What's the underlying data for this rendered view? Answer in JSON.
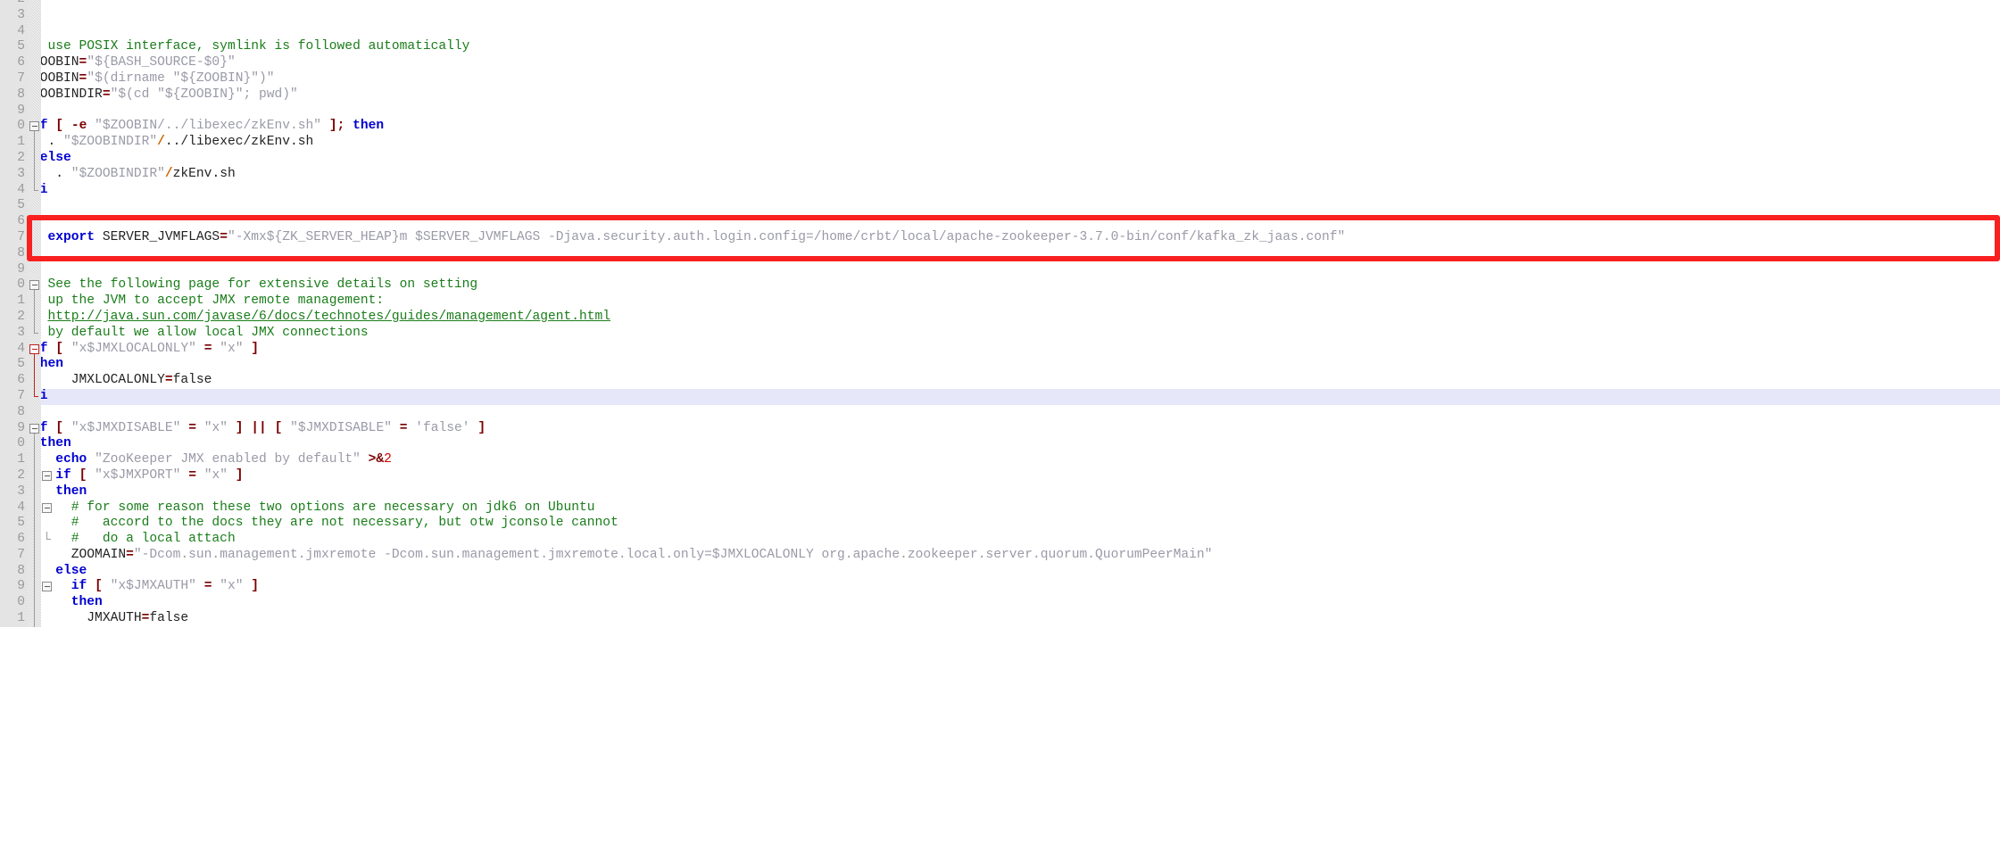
{
  "editor": {
    "kind": "code-editor",
    "language": "shell",
    "colors": {
      "background": "#ffffff",
      "gutter_background": "#e4e4e4",
      "gutter_text": "#9a9a9a",
      "current_line_highlight": "#e7e7fa",
      "keyword": "#0000d0",
      "comment": "#1a7d1a",
      "string": "#9a9aa8",
      "operator": "#7a0000",
      "number": "#d00000",
      "annotation_box": "#f92020"
    },
    "annotation": {
      "name": "red-highlight-box",
      "target_line": "7",
      "description": "export SERVER_JVMFLAGS line"
    },
    "lines": [
      {
        "num": "2",
        "clipped_top": true,
        "fold": "none",
        "tokens": [
          {
            "t": "#",
            "c": "cmt"
          }
        ]
      },
      {
        "num": "3",
        "fold": "none",
        "tokens": []
      },
      {
        "num": "4",
        "fold": "none",
        "tokens": []
      },
      {
        "num": "5",
        "fold": "none",
        "tokens": [
          {
            "t": "# use POSIX interface, symlink is followed automatically",
            "c": "cmt"
          }
        ]
      },
      {
        "num": "6",
        "fold": "none",
        "tokens": [
          {
            "t": "ZOOBIN",
            "c": "plain"
          },
          {
            "t": "=",
            "c": "op"
          },
          {
            "t": "\"${BASH_SOURCE-$0}\"",
            "c": "str"
          }
        ]
      },
      {
        "num": "7",
        "fold": "none",
        "tokens": [
          {
            "t": "ZOOBIN",
            "c": "plain"
          },
          {
            "t": "=",
            "c": "op"
          },
          {
            "t": "\"$(dirname \"${ZOOBIN}\")\"",
            "c": "str"
          }
        ]
      },
      {
        "num": "8",
        "fold": "none",
        "tokens": [
          {
            "t": "ZOOBINDIR",
            "c": "plain"
          },
          {
            "t": "=",
            "c": "op"
          },
          {
            "t": "\"$(cd \"${ZOOBIN}\"; pwd)\"",
            "c": "str"
          }
        ]
      },
      {
        "num": "9",
        "fold": "none",
        "tokens": []
      },
      {
        "num": "0",
        "fold": "start",
        "tokens": [
          {
            "t": "if",
            "c": "kw"
          },
          {
            "t": " ",
            "c": "plain"
          },
          {
            "t": "[",
            "c": "op"
          },
          {
            "t": " ",
            "c": "plain"
          },
          {
            "t": "-e",
            "c": "op"
          },
          {
            "t": " ",
            "c": "plain"
          },
          {
            "t": "\"$ZOOBIN/../libexec/zkEnv.sh\"",
            "c": "str"
          },
          {
            "t": " ",
            "c": "plain"
          },
          {
            "t": "];",
            "c": "op"
          },
          {
            "t": " ",
            "c": "plain"
          },
          {
            "t": "then",
            "c": "kw"
          }
        ]
      },
      {
        "num": "1",
        "fold": "mid",
        "tokens": [
          {
            "t": "  . ",
            "c": "plain"
          },
          {
            "t": "\"$ZOOBINDIR\"",
            "c": "str"
          },
          {
            "t": "/",
            "c": "slash"
          },
          {
            "t": "../libexec/zkEnv.sh",
            "c": "plain"
          }
        ]
      },
      {
        "num": "2",
        "fold": "mid",
        "tokens": [
          {
            "t": " else",
            "c": "kw"
          }
        ]
      },
      {
        "num": "3",
        "fold": "mid",
        "tokens": [
          {
            "t": "   . ",
            "c": "plain"
          },
          {
            "t": "\"$ZOOBINDIR\"",
            "c": "str"
          },
          {
            "t": "/",
            "c": "slash"
          },
          {
            "t": "zkEnv.sh",
            "c": "plain"
          }
        ]
      },
      {
        "num": "4",
        "fold": "end",
        "tokens": [
          {
            "t": "fi",
            "c": "kw"
          }
        ]
      },
      {
        "num": "5",
        "fold": "none",
        "tokens": []
      },
      {
        "num": "6",
        "fold": "none",
        "tokens": []
      },
      {
        "num": "7",
        "fold": "none",
        "boxed": true,
        "tokens": [
          {
            "t": "  ",
            "c": "plain"
          },
          {
            "t": "export",
            "c": "kw"
          },
          {
            "t": " SERVER_JVMFLAGS",
            "c": "plain"
          },
          {
            "t": "=",
            "c": "op"
          },
          {
            "t": "\"-Xmx${ZK_SERVER_HEAP}m $SERVER_JVMFLAGS -Djava.security.auth.login.config=/home/crbt/local/apache-zookeeper-3.7.0-bin/conf/kafka_zk_jaas.conf\"",
            "c": "str"
          }
        ]
      },
      {
        "num": "8",
        "fold": "none",
        "tokens": []
      },
      {
        "num": "9",
        "fold": "none",
        "tokens": []
      },
      {
        "num": "0",
        "fold": "start",
        "tokens": [
          {
            "t": "# See the following page for extensive details on setting",
            "c": "cmt"
          }
        ]
      },
      {
        "num": "1",
        "fold": "mid",
        "tokens": [
          {
            "t": "# up the JVM to accept JMX remote management:",
            "c": "cmt"
          }
        ]
      },
      {
        "num": "2",
        "fold": "mid",
        "tokens": [
          {
            "t": "# ",
            "c": "cmt"
          },
          {
            "t": "http://java.sun.com/javase/6/docs/technotes/guides/management/agent.html",
            "c": "lnk"
          }
        ]
      },
      {
        "num": "3",
        "fold": "end",
        "tokens": [
          {
            "t": "# by default we allow local JMX connections",
            "c": "cmt"
          }
        ]
      },
      {
        "num": "4",
        "fold": "start-red",
        "tokens": [
          {
            "t": "if",
            "c": "kw"
          },
          {
            "t": " ",
            "c": "plain"
          },
          {
            "t": "[",
            "c": "op"
          },
          {
            "t": " ",
            "c": "plain"
          },
          {
            "t": "\"x$JMXLOCALONLY\"",
            "c": "str"
          },
          {
            "t": " ",
            "c": "plain"
          },
          {
            "t": "=",
            "c": "op"
          },
          {
            "t": " ",
            "c": "plain"
          },
          {
            "t": "\"x\"",
            "c": "str"
          },
          {
            "t": " ",
            "c": "plain"
          },
          {
            "t": "]",
            "c": "op"
          }
        ]
      },
      {
        "num": "5",
        "fold": "mid-red",
        "tokens": [
          {
            "t": "then",
            "c": "kw"
          }
        ]
      },
      {
        "num": "6",
        "fold": "mid-red",
        "tokens": [
          {
            "t": "     JMXLOCALONLY",
            "c": "plain"
          },
          {
            "t": "=",
            "c": "op"
          },
          {
            "t": "false",
            "c": "plain"
          }
        ]
      },
      {
        "num": "7",
        "fold": "end-red",
        "current": true,
        "tokens": [
          {
            "t": "fi",
            "c": "kw"
          }
        ]
      },
      {
        "num": "8",
        "fold": "none",
        "tokens": []
      },
      {
        "num": "9",
        "fold": "start",
        "tokens": [
          {
            "t": "if",
            "c": "kw"
          },
          {
            "t": " ",
            "c": "plain"
          },
          {
            "t": "[",
            "c": "op"
          },
          {
            "t": " ",
            "c": "plain"
          },
          {
            "t": "\"x$JMXDISABLE\"",
            "c": "str"
          },
          {
            "t": " ",
            "c": "plain"
          },
          {
            "t": "=",
            "c": "op"
          },
          {
            "t": " ",
            "c": "plain"
          },
          {
            "t": "\"x\"",
            "c": "str"
          },
          {
            "t": " ",
            "c": "plain"
          },
          {
            "t": "]",
            "c": "op"
          },
          {
            "t": " ",
            "c": "plain"
          },
          {
            "t": "||",
            "c": "op"
          },
          {
            "t": " ",
            "c": "plain"
          },
          {
            "t": "[",
            "c": "op"
          },
          {
            "t": " ",
            "c": "plain"
          },
          {
            "t": "\"$JMXDISABLE\"",
            "c": "str"
          },
          {
            "t": " ",
            "c": "plain"
          },
          {
            "t": "=",
            "c": "op"
          },
          {
            "t": " ",
            "c": "plain"
          },
          {
            "t": "'false'",
            "c": "str"
          },
          {
            "t": " ",
            "c": "plain"
          },
          {
            "t": "]",
            "c": "op"
          }
        ]
      },
      {
        "num": "0",
        "fold": "mid",
        "tokens": [
          {
            "t": " then",
            "c": "kw"
          }
        ]
      },
      {
        "num": "1",
        "fold": "mid",
        "tokens": [
          {
            "t": "   ",
            "c": "plain"
          },
          {
            "t": "echo",
            "c": "kw"
          },
          {
            "t": " ",
            "c": "plain"
          },
          {
            "t": "\"ZooKeeper JMX enabled by default\"",
            "c": "str"
          },
          {
            "t": " ",
            "c": "plain"
          },
          {
            "t": ">&",
            "c": "op"
          },
          {
            "t": "2",
            "c": "num"
          }
        ]
      },
      {
        "num": "2",
        "fold": "mid",
        "inner_fold": "start",
        "tokens": [
          {
            "t": "   ",
            "c": "plain"
          },
          {
            "t": "if",
            "c": "kw"
          },
          {
            "t": " ",
            "c": "plain"
          },
          {
            "t": "[",
            "c": "op"
          },
          {
            "t": " ",
            "c": "plain"
          },
          {
            "t": "\"x$JMXPORT\"",
            "c": "str"
          },
          {
            "t": " ",
            "c": "plain"
          },
          {
            "t": "=",
            "c": "op"
          },
          {
            "t": " ",
            "c": "plain"
          },
          {
            "t": "\"x\"",
            "c": "str"
          },
          {
            "t": " ",
            "c": "plain"
          },
          {
            "t": "]",
            "c": "op"
          }
        ]
      },
      {
        "num": "3",
        "fold": "mid",
        "tokens": [
          {
            "t": "   then",
            "c": "kw"
          }
        ]
      },
      {
        "num": "4",
        "fold": "mid",
        "inner_fold": "start",
        "tokens": [
          {
            "t": "     # for some reason these two options are necessary on jdk6 on Ubuntu",
            "c": "cmt"
          }
        ]
      },
      {
        "num": "5",
        "fold": "mid",
        "tokens": [
          {
            "t": "     #   accord to the docs they are not necessary, but otw jconsole cannot",
            "c": "cmt"
          }
        ]
      },
      {
        "num": "6",
        "fold": "mid",
        "inner_fold": "end",
        "tokens": [
          {
            "t": "     #   do a local attach",
            "c": "cmt"
          }
        ]
      },
      {
        "num": "7",
        "fold": "mid",
        "tokens": [
          {
            "t": "     ZOOMAIN",
            "c": "plain"
          },
          {
            "t": "=",
            "c": "op"
          },
          {
            "t": "\"-Dcom.sun.management.jmxremote -Dcom.sun.management.jmxremote.local.only=$JMXLOCALONLY org.apache.zookeeper.server.quorum.QuorumPeerMain\"",
            "c": "str"
          }
        ]
      },
      {
        "num": "8",
        "fold": "mid",
        "tokens": [
          {
            "t": "   else",
            "c": "kw"
          }
        ]
      },
      {
        "num": "9",
        "fold": "mid",
        "inner_fold": "start",
        "tokens": [
          {
            "t": "     ",
            "c": "plain"
          },
          {
            "t": "if",
            "c": "kw"
          },
          {
            "t": " ",
            "c": "plain"
          },
          {
            "t": "[",
            "c": "op"
          },
          {
            "t": " ",
            "c": "plain"
          },
          {
            "t": "\"x$JMXAUTH\"",
            "c": "str"
          },
          {
            "t": " ",
            "c": "plain"
          },
          {
            "t": "=",
            "c": "op"
          },
          {
            "t": " ",
            "c": "plain"
          },
          {
            "t": "\"x\"",
            "c": "str"
          },
          {
            "t": " ",
            "c": "plain"
          },
          {
            "t": "]",
            "c": "op"
          }
        ]
      },
      {
        "num": "0",
        "fold": "mid",
        "tokens": [
          {
            "t": "     then",
            "c": "kw"
          }
        ]
      },
      {
        "num": "1",
        "fold": "mid",
        "clipped_bottom": true,
        "tokens": [
          {
            "t": "       JMXAUTH",
            "c": "plain"
          },
          {
            "t": "=",
            "c": "op"
          },
          {
            "t": "false",
            "c": "plain"
          }
        ]
      }
    ]
  }
}
